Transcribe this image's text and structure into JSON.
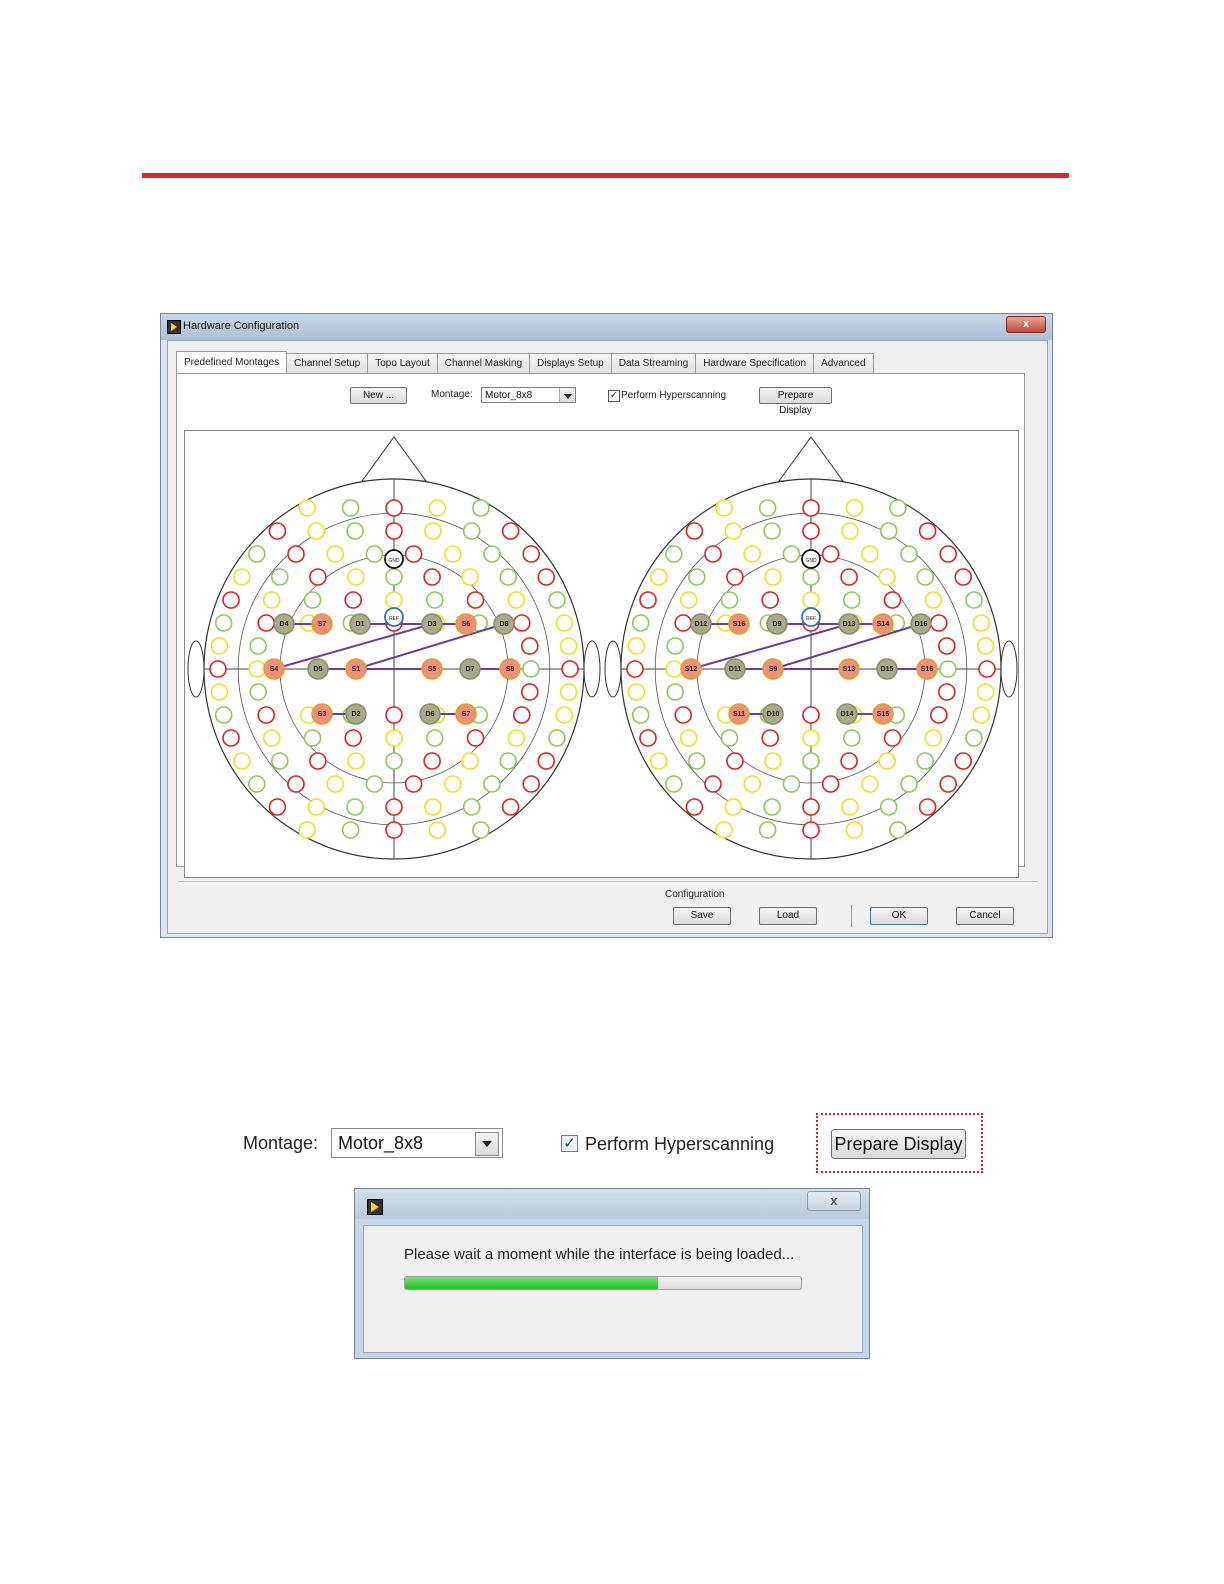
{
  "window": {
    "title": "Hardware Configuration",
    "close_glyph": "x",
    "tabs": [
      {
        "label": "Predefined Montages",
        "active": true
      },
      {
        "label": "Channel Setup",
        "active": false
      },
      {
        "label": "Topo Layout",
        "active": false
      },
      {
        "label": "Channel Masking",
        "active": false
      },
      {
        "label": "Displays Setup",
        "active": false
      },
      {
        "label": "Data Streaming",
        "active": false
      },
      {
        "label": "Hardware Specification",
        "active": false
      },
      {
        "label": "Advanced",
        "active": false
      }
    ],
    "toolbar": {
      "new_label": "New ...",
      "montage_label": "Montage:",
      "montage_value": "Motor_8x8",
      "hyperscan_label": "Perform Hyperscanning",
      "hyperscan_checked": true,
      "prepare_label": "Prepare Display"
    },
    "configuration": {
      "group_label": "Configuration",
      "save_label": "Save",
      "load_label": "Load",
      "ok_label": "OK",
      "cancel_label": "Cancel"
    },
    "montage_map": {
      "colors": {
        "red": "#e02020",
        "yellow": "#f0e020",
        "green": "#8cc85a",
        "blue": "#2f6fc0",
        "source": "#f0907a",
        "detector": "#a8aa88",
        "link": "#6a3d9a"
      },
      "center_labels": {
        "gnd": "GND",
        "ref": "REF"
      },
      "left": {
        "sources": [
          "S7",
          "S6",
          "S4",
          "S1",
          "S5",
          "S8",
          "S3",
          "S7"
        ],
        "detectors": [
          "D4",
          "D1",
          "D3",
          "D8",
          "D5",
          "D7",
          "D2",
          "D6"
        ]
      },
      "right": {
        "sources": [
          "S16",
          "S14",
          "S12",
          "S9",
          "S13",
          "S16",
          "S11",
          "S15"
        ],
        "detectors": [
          "D12",
          "D9",
          "D13",
          "D16",
          "D11",
          "D15",
          "D10",
          "D14"
        ]
      }
    }
  },
  "zoom": {
    "montage_label": "Montage:",
    "montage_value": "Motor_8x8",
    "hyperscan_label": "Perform Hyperscanning",
    "hyperscan_checked": true,
    "prepare_label": "Prepare Display"
  },
  "loading_dialog": {
    "close_glyph": "x",
    "message": "Please wait a moment while the interface is being loaded...",
    "progress": 0.64
  }
}
